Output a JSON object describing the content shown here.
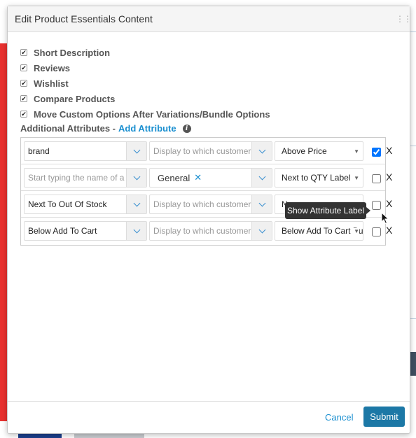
{
  "modal": {
    "title": "Edit Product Essentials Content"
  },
  "options": [
    {
      "label": "Short Description",
      "checked": true
    },
    {
      "label": "Reviews",
      "checked": true
    },
    {
      "label": "Wishlist",
      "checked": true
    },
    {
      "label": "Compare Products",
      "checked": true
    },
    {
      "label": "Move Custom Options After Variations/Bundle Options",
      "checked": true
    }
  ],
  "additional": {
    "label": "Additional Attributes -",
    "link": "Add Attribute"
  },
  "rows": [
    {
      "attribute": "brand",
      "display_placeholder": "Display to which customer",
      "position": "Above Price",
      "show_label": true
    },
    {
      "attribute_placeholder": "Start typing the name of a",
      "display_tag": "General",
      "position": "Next to QTY Label",
      "show_label": false
    },
    {
      "attribute": "Next To Out Of Stock",
      "display_placeholder": "Display to which customer",
      "position": "N",
      "show_label": false
    },
    {
      "attribute": "Below Add To Cart",
      "display_placeholder": "Display to which customer",
      "position": "Below Add To Cart Bu",
      "show_label": false
    }
  ],
  "remove_label": "X",
  "tag_remove": "✕",
  "tooltip": "Show Attribute Label",
  "footer": {
    "cancel": "Cancel",
    "submit": "Submit"
  },
  "colors": {
    "accent": "#1a8fd0",
    "submit_bg": "#1c78a6",
    "bg_red": "#e8312f"
  }
}
